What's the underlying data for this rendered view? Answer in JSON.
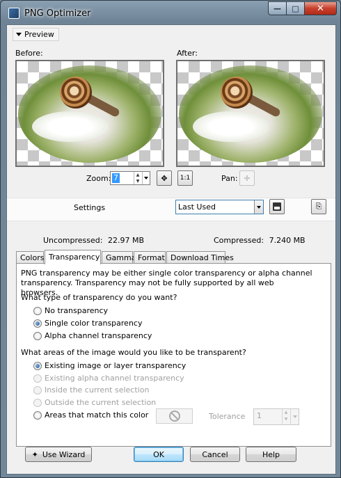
{
  "window": {
    "title": "PNG Optimizer",
    "minimize": "—",
    "maximize": "□",
    "close": "✕"
  },
  "preview": {
    "toggle_label": "Preview",
    "before_label": "Before:",
    "after_label": "After:",
    "zoom_label": "Zoom:",
    "zoom_value": "7",
    "pan_label": "Pan:",
    "zoom_to_fit_icon": "zoom-to-fit-icon",
    "actual_size_label": "1:1"
  },
  "settings": {
    "label": "Settings",
    "selected": "Last Used",
    "uncompressed_label": "Uncompressed:",
    "uncompressed_value": "22.97 MB",
    "compressed_label": "Compressed:",
    "compressed_value": "7.240 MB"
  },
  "tabs": [
    "Colors",
    "Transparency",
    "Gamma",
    "Format",
    "Download Times"
  ],
  "active_tab": "Transparency",
  "transparency": {
    "intro": "PNG transparency may be either single color transparency or alpha channel transparency. Transparency may not be fully supported by all web browsers.",
    "type_question": "What type of transparency do you want?",
    "type_options": [
      {
        "label": "No transparency",
        "selected": false,
        "enabled": true
      },
      {
        "label": "Single color transparency",
        "selected": true,
        "enabled": true
      },
      {
        "label": "Alpha channel transparency",
        "selected": false,
        "enabled": true
      }
    ],
    "area_question": "What areas of the image would you like to be transparent?",
    "area_options": [
      {
        "label": "Existing image or layer transparency",
        "selected": true,
        "enabled": true
      },
      {
        "label": "Existing alpha channel transparency",
        "selected": false,
        "enabled": false
      },
      {
        "label": "Inside the current selection",
        "selected": false,
        "enabled": false
      },
      {
        "label": "Outside the current selection",
        "selected": false,
        "enabled": false
      },
      {
        "label": "Areas that match this color",
        "selected": false,
        "enabled": true
      }
    ],
    "tolerance_label": "Tolerance",
    "tolerance_value": "1"
  },
  "buttons": {
    "wizard": "Use Wizard",
    "ok": "OK",
    "cancel": "Cancel",
    "help": "Help"
  },
  "colors": {
    "accent": "#3399ff",
    "default_button_border": "#3c7fb1",
    "title_close": "#c6402c"
  }
}
